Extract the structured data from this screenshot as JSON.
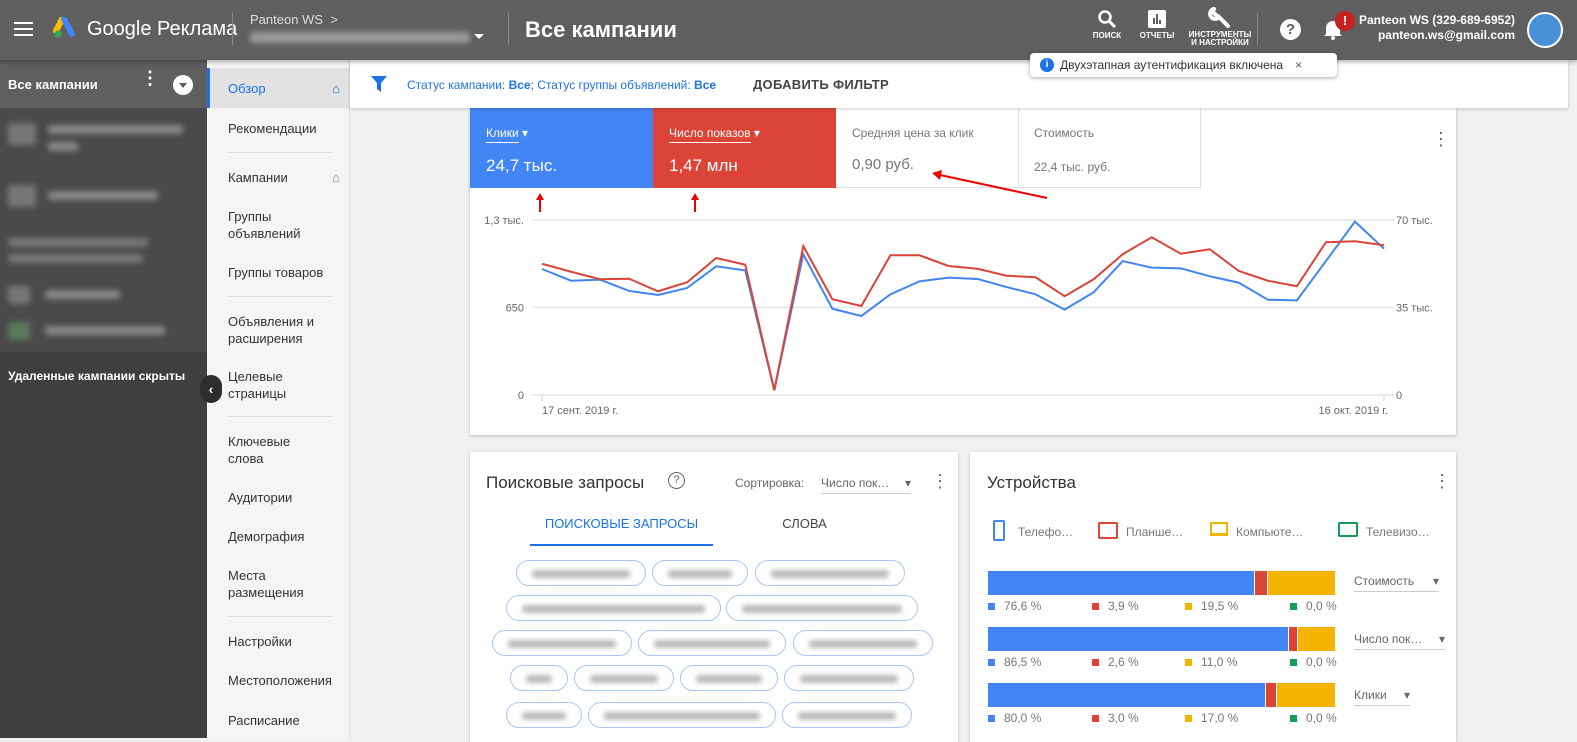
{
  "header": {
    "brand": "Google Реклама",
    "account_path": "Panteon WS",
    "account_chevron": ">",
    "page_title": "Все кампании",
    "tools": [
      {
        "icon": "search-icon",
        "label": "ПОИСК"
      },
      {
        "icon": "reports-icon",
        "label": "ОТЧЕТЫ"
      },
      {
        "icon": "wrench-icon",
        "label": "ИНСТРУМЕНТЫ И НАСТРОЙКИ"
      }
    ],
    "notification_badge": "!",
    "account_name": "Panteon WS (329-689-6952)",
    "account_email": "panteon.ws@gmail.com"
  },
  "toast": {
    "text": "Двухэтапная аутентификация включена",
    "close": "×"
  },
  "sidebar": {
    "title": "Все кампании",
    "footer": "Удаленные кампании скрыты"
  },
  "nav": {
    "items": [
      {
        "label": "Обзор",
        "active": true
      },
      {
        "label": "Рекомендации"
      },
      {
        "label": "Кампании"
      },
      {
        "label": "Группы объявлений"
      },
      {
        "label": "Группы товаров"
      },
      {
        "label": "Объявления и расширения"
      },
      {
        "label": "Целевые страницы"
      },
      {
        "label": "Ключевые слова"
      },
      {
        "label": "Аудитории"
      },
      {
        "label": "Демография"
      },
      {
        "label": "Места размещения"
      },
      {
        "label": "Настройки"
      },
      {
        "label": "Местоположения"
      },
      {
        "label": "Расписание"
      }
    ]
  },
  "filter": {
    "status_prefix": "Статус кампании: ",
    "status_value": "Все",
    "group_prefix": "; Статус группы объявлений: ",
    "group_value": "Все",
    "add_filter": "ДОБАВИТЬ ФИЛЬТР"
  },
  "metrics": [
    {
      "label": "Клики",
      "value": "24,7 тыс.",
      "color": "#4285f4",
      "selected": true
    },
    {
      "label": "Число показов",
      "value": "1,47 млн",
      "color": "#db4437",
      "selected": true
    },
    {
      "label": "Средняя цена за клик",
      "value": "0,90 руб."
    },
    {
      "label": "Стоимость",
      "value": "22,4 тыс. руб."
    }
  ],
  "chart_data": {
    "type": "line",
    "x_start_label": "17 сент. 2019 г.",
    "x_end_label": "16 окт. 2019 г.",
    "x_range": [
      "2019-09-17",
      "2019-10-16"
    ],
    "left_axis": {
      "ticks": [
        "0",
        "650",
        "1,3 тыс."
      ],
      "range": [
        0,
        1300
      ]
    },
    "right_axis": {
      "ticks": [
        "0",
        "35 тыс.",
        "70 тыс."
      ],
      "range": [
        0,
        70000
      ]
    },
    "grid": true,
    "series": [
      {
        "name": "Клики",
        "axis": "left",
        "color": "#4285f4",
        "values": [
          936,
          849,
          857,
          773,
          743,
          795,
          956,
          926,
          35,
          1045,
          641,
          587,
          748,
          844,
          872,
          862,
          802,
          748,
          634,
          763,
          995,
          946,
          941,
          882,
          834,
          708,
          703,
          995,
          1288,
          1087
        ]
      },
      {
        "name": "Число показов",
        "axis": "right",
        "color": "#db4437",
        "values": [
          52500,
          49300,
          46300,
          46500,
          41500,
          45100,
          54800,
          52100,
          1900,
          59600,
          38300,
          35600,
          55900,
          55900,
          51600,
          50500,
          47700,
          47100,
          39500,
          46300,
          56300,
          63100,
          56500,
          58300,
          49600,
          45700,
          43500,
          61100,
          61500,
          59900
        ]
      }
    ]
  },
  "search_queries": {
    "title": "Поисковые запросы",
    "sort_label": "Сортировка:",
    "sort_value": "Число пок…",
    "tabs": [
      "ПОИСКОВЫЕ ЗАПРОСЫ",
      "СЛОВА"
    ]
  },
  "devices": {
    "title": "Устройства",
    "legend": [
      {
        "label": "Телефо…",
        "color": "#4285f4",
        "icon": "phone-icon"
      },
      {
        "label": "Планше…",
        "color": "#db4437",
        "icon": "tablet-icon"
      },
      {
        "label": "Компьюте…",
        "color": "#f4b400",
        "icon": "laptop-icon"
      },
      {
        "label": "Телевизо…",
        "color": "#0f9d58",
        "icon": "tv-icon"
      }
    ],
    "rows": [
      {
        "metric": "Стоимость",
        "values": [
          76.6,
          3.9,
          19.5,
          0.0
        ],
        "labels": [
          "76,6 %",
          "3,9 %",
          "19,5 %",
          "0,0 %"
        ]
      },
      {
        "metric": "Число пок…",
        "values": [
          86.5,
          2.6,
          11.0,
          0.0
        ],
        "labels": [
          "86,5 %",
          "2,6 %",
          "11,0 %",
          "0,0 %"
        ]
      },
      {
        "metric": "Клики",
        "values": [
          80.0,
          3.0,
          17.0,
          0.0
        ],
        "labels": [
          "80,0 %",
          "3,0 %",
          "17,0 %",
          "0,0 %"
        ]
      }
    ]
  }
}
